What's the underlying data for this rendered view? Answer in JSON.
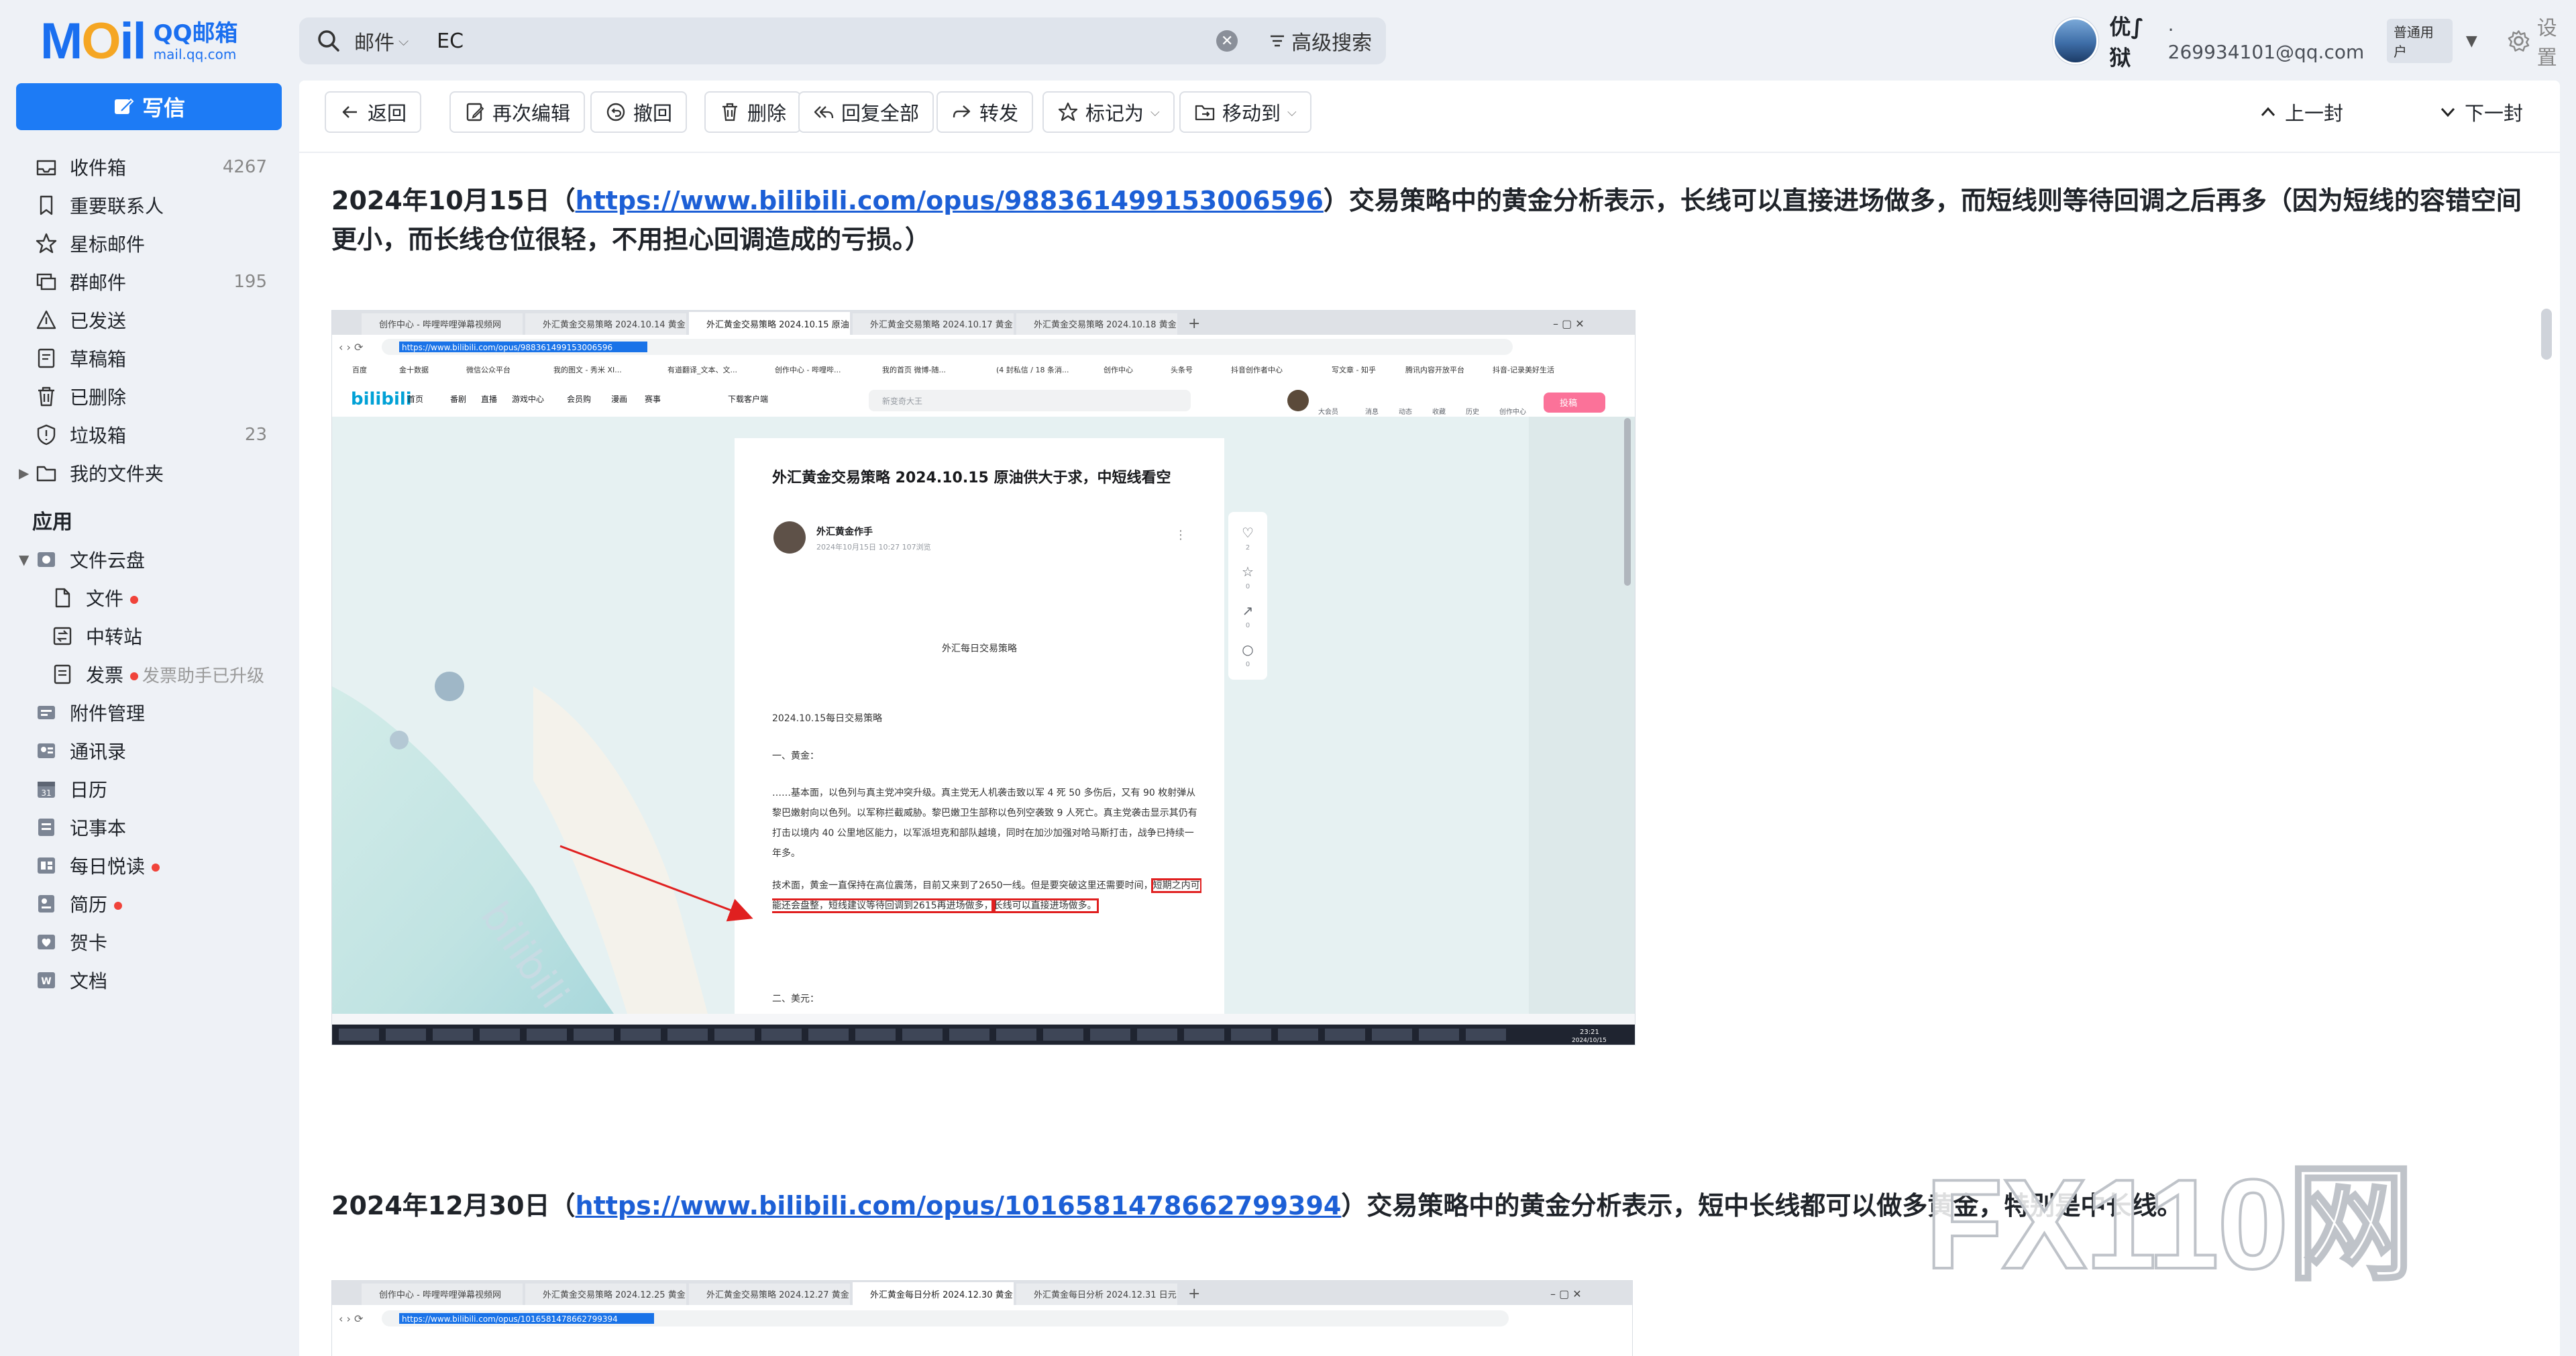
{
  "app": {
    "logo_mail": "MOil",
    "logo_cn": "QQ邮箱",
    "logo_url": "mail.qq.com"
  },
  "search": {
    "scope": "邮件",
    "query": "EC",
    "advanced": "高级搜索"
  },
  "user": {
    "name": "优∫狱",
    "email": "· 269934101@qq.com",
    "badge": "普通用户",
    "settings": "设置"
  },
  "compose_label": "写信",
  "folders": [
    {
      "label": "收件箱",
      "count": "4267",
      "icon": "inbox-icon"
    },
    {
      "label": "重要联系人",
      "count": "",
      "icon": "bookmark-icon"
    },
    {
      "label": "星标邮件",
      "count": "",
      "icon": "star-icon"
    },
    {
      "label": "群邮件",
      "count": "195",
      "icon": "group-mail-icon"
    },
    {
      "label": "已发送",
      "count": "",
      "icon": "sent-icon"
    },
    {
      "label": "草稿箱",
      "count": "",
      "icon": "draft-icon"
    },
    {
      "label": "已删除",
      "count": "",
      "icon": "trash-icon"
    },
    {
      "label": "垃圾箱",
      "count": "23",
      "icon": "shield-icon"
    },
    {
      "label": "我的文件夹",
      "count": "",
      "icon": "folder-icon"
    }
  ],
  "apps_title": "应用",
  "cloud": {
    "label": "文件云盘",
    "items": [
      {
        "label": "文件",
        "hint": ""
      },
      {
        "label": "中转站",
        "hint": ""
      },
      {
        "label": "发票",
        "hint": "发票助手已升级"
      }
    ]
  },
  "apps": [
    {
      "label": "附件管理",
      "dot": false
    },
    {
      "label": "通讯录",
      "dot": false
    },
    {
      "label": "日历",
      "dot": false
    },
    {
      "label": "记事本",
      "dot": false
    },
    {
      "label": "每日悦读",
      "dot": true
    },
    {
      "label": "简历",
      "dot": true
    },
    {
      "label": "贺卡",
      "dot": false
    },
    {
      "label": "文档",
      "dot": false
    }
  ],
  "toolbar": {
    "back": "返回",
    "reedit": "再次编辑",
    "recall": "撤回",
    "delete": "删除",
    "reply_all": "回复全部",
    "forward": "转发",
    "mark_as": "标记为",
    "move_to": "移动到",
    "prev": "上一封",
    "next": "下一封"
  },
  "mail": {
    "para1_date": "2024年10月15日（",
    "para1_link": "https://www.bilibili.com/opus/988361499153006596",
    "para1_text": "）交易策略中的黄金分析表示，长线可以直接进场做多，而短线则等待回调之后再多（因为短线的容错空间更小，而长线仓位很轻，不用担心回调造成的亏损。）",
    "para2_date": "2024年12月30日（",
    "para2_link": "https://www.bilibili.com/opus/1016581478662799394",
    "para2_text": "）交易策略中的黄金分析表示，短中长线都可以做多黄金，特别是中长线。"
  },
  "screenshot1": {
    "tabs": [
      "创作中心 - 哔哩哔哩弹幕视频网",
      "外汇黄金交易策略 2024.10.14 黄金",
      "外汇黄金交易策略 2024.10.15 原油",
      "外汇黄金交易策略 2024.10.17 黄金",
      "外汇黄金交易策略 2024.10.18 黄金"
    ],
    "url": "https://www.bilibili.com/opus/988361499153006596",
    "bookmarks": [
      "百度",
      "金十数据",
      "微信公众平台",
      "我的图文 - 秀米 XI...",
      "有道翻译_文本、文...",
      "创作中心 - 哔哩哔...",
      "我的首页 微博-随...",
      "(4 封私信 / 18 条消...",
      "创作中心",
      "头条号",
      "抖音创作者中心",
      "写文章 - 知乎",
      "腾讯内容开放平台",
      "抖音-记录美好生活"
    ],
    "site_logo": "bilibili",
    "site_nav": [
      "首页",
      "番剧",
      "直播",
      "游戏中心",
      "会员购",
      "漫画",
      "赛事"
    ],
    "download": "下载客户端",
    "search_placeholder": "新变奇大王",
    "header_icons": [
      "大会员",
      "消息",
      "动态",
      "收藏",
      "历史",
      "创作中心"
    ],
    "upload": "投稿",
    "article_title": "外汇黄金交易策略 2024.10.15 原油供大于求，中短线看空",
    "author": "外汇黄金作手",
    "meta": "2024年10月15日 10:27 107浏览",
    "image_caption": "外汇每日交易策略",
    "p_date": "2024.10.15每日交易策略",
    "p_gold": "一、黄金：",
    "p_fund": "……基本面，以色列与真主党冲突升级。真主党无人机袭击致以军 4 死 50 多伤后，又有 90 枚射弹从黎巴嫩射向以色列。以军称拦截威胁。黎巴嫩卫生部称以色列空袭致 9 人死亡。真主党袭击显示其仍有打击以境内 40 公里地区能力，以军派坦克和部队越境，同时在加沙加强对哈马斯打击，战争已持续一年多。",
    "p_tech_pre": "技术面，黄金一直保持在高位震荡，目前又来到了2650一线。但是要突破这里还需要时间，",
    "p_tech_hl1": "短期之内可能还会盘整，短线建议等待回调到2615再进场做多，",
    "p_tech_hl2": "长线可以直接进场做多。",
    "p_usd": "二、美元：",
    "side_counts": [
      "2",
      "0",
      "0",
      "0"
    ],
    "status_time": "23:21",
    "status_date": "2024/10/15"
  },
  "screenshot2": {
    "tabs": [
      "创作中心 - 哔哩哔哩弹幕视频网",
      "外汇黄金交易策略 2024.12.25 黄金",
      "外汇黄金交易策略 2024.12.27 黄金",
      "外汇黄金每日分析 2024.12.30 黄金",
      "外汇黄金每日分析 2024.12.31 日元"
    ],
    "url": "https://www.bilibili.com/opus/1016581478662799394"
  },
  "watermark": "FX110网"
}
